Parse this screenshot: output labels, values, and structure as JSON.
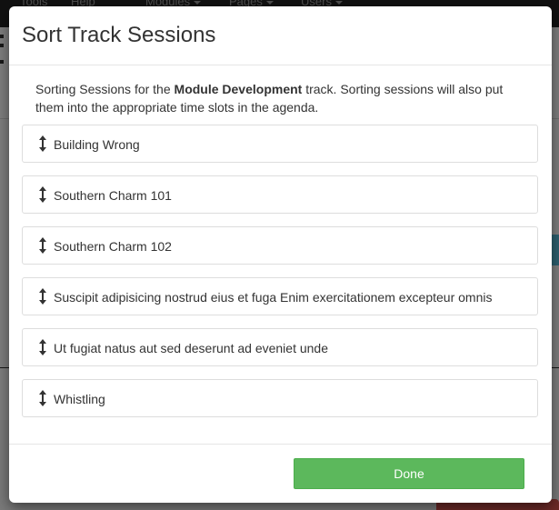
{
  "background": {
    "navbar": {
      "items": [
        {
          "label": "Tools",
          "has_caret": false
        },
        {
          "label": "Help",
          "has_caret": false
        },
        {
          "label": "Modules",
          "has_caret": true
        },
        {
          "label": "Pages",
          "has_caret": true
        },
        {
          "label": "Users",
          "has_caret": true
        }
      ]
    }
  },
  "modal": {
    "title": "Sort Track Sessions",
    "intro": {
      "prefix": "Sorting Sessions for the ",
      "track_name": "Module Development",
      "suffix": " track. Sorting sessions will also put them into the appropriate time slots in the agenda."
    },
    "sessions": [
      {
        "label": "Building Wrong",
        "icon": "drag-vertical-arrows-icon"
      },
      {
        "label": "Southern Charm 101",
        "icon": "drag-vertical-arrows-icon"
      },
      {
        "label": "Southern Charm 102",
        "icon": "drag-vertical-arrows-icon"
      },
      {
        "label": "Suscipit adipisicing nostrud eius et fuga Enim exercitationem excepteur omnis",
        "icon": "drag-vertical-arrows-icon"
      },
      {
        "label": "Ut fugiat natus aut sed deserunt ad eveniet unde",
        "icon": "drag-vertical-arrows-icon"
      },
      {
        "label": "Whistling",
        "icon": "drag-vertical-arrows-icon"
      }
    ],
    "footer": {
      "done_label": "Done"
    }
  },
  "colors": {
    "done_button": "#5cb85c",
    "navbar": "#222222",
    "overlay": "rgba(0,0,0,0.5)",
    "text": "#333333"
  }
}
